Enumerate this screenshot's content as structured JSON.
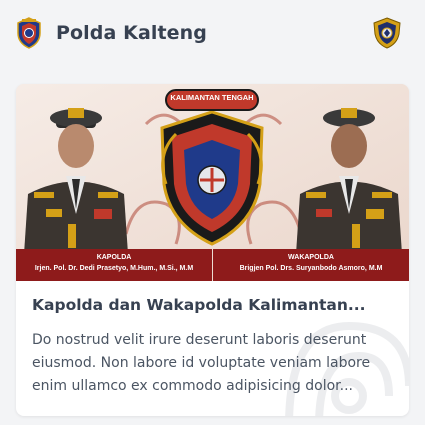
{
  "header": {
    "title": "Polda Kalteng",
    "left_logo": "polda-kalteng-emblem-icon",
    "right_logo": "polri-badge-icon"
  },
  "card": {
    "banner": {
      "badge_text": "KALIMANTAN TENGAH",
      "left_caption_role": "KAPOLDA",
      "left_caption_name": "Irjen. Pol. Dr. Dedi Prasetyo, M.Hum., M.Si., M.M",
      "right_caption_role": "WAKAPOLDA",
      "right_caption_name": "Brigjen Pol. Drs. Suryanbodo Asmoro, M.M"
    },
    "title": "Kapolda dan Wakapolda Kalimantan...",
    "excerpt": "Do nostrud velit irure deserunt laboris deserunt eiusmod. Non labore id voluptate veniam labore enim ullamco ex commodo adipisicing dolor..."
  },
  "colors": {
    "background": "#f3f4f6",
    "card": "#ffffff",
    "caption_bar": "#8e1b1b",
    "title_text": "#374151",
    "body_text": "#4b5563"
  }
}
